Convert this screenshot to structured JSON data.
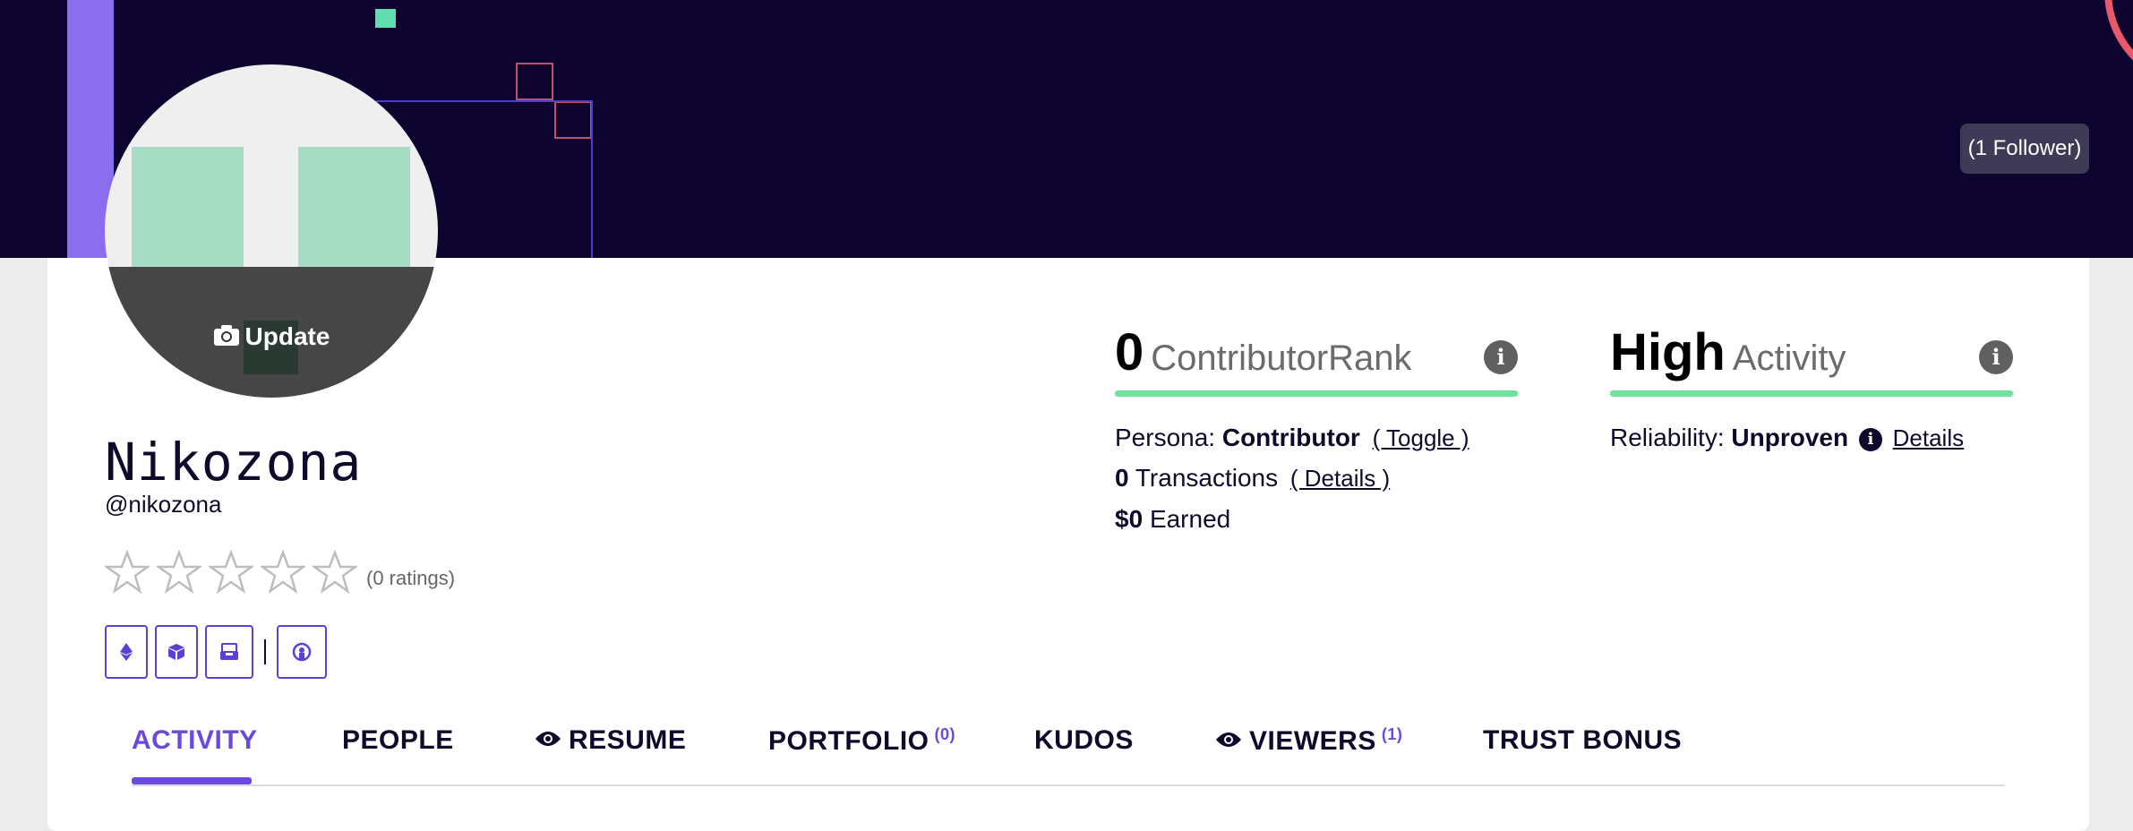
{
  "banner": {
    "follower_badge": "(1 Follower)"
  },
  "avatar": {
    "update_label": "Update"
  },
  "profile": {
    "name": "Nikozona",
    "handle": "@nikozona",
    "ratings_text": "(0 ratings)",
    "stars_filled": 0,
    "stars_total": 5
  },
  "icon_buttons": [
    "ethereum-icon",
    "cube-icon",
    "inbox-icon",
    "github-icon"
  ],
  "contributor": {
    "rank_value": "0",
    "rank_label": "ContributorRank",
    "persona_label": "Persona:",
    "persona_value": "Contributor",
    "persona_link": "( Toggle )",
    "transactions_value": "0",
    "transactions_label": "Transactions",
    "transactions_link": "( Details )",
    "earned_value": "$0",
    "earned_label": "Earned"
  },
  "activity": {
    "level_value": "High",
    "level_label": "Activity",
    "reliability_label": "Reliability:",
    "reliability_value": "Unproven",
    "reliability_link": "Details"
  },
  "tabs": [
    {
      "label": "ACTIVITY",
      "active": true
    },
    {
      "label": "PEOPLE"
    },
    {
      "label": "RESUME",
      "icon": "eye-icon"
    },
    {
      "label": "PORTFOLIO",
      "count": "(0)"
    },
    {
      "label": "KUDOS"
    },
    {
      "label": "VIEWERS",
      "icon": "eye-icon",
      "count": "(1)"
    },
    {
      "label": "TRUST BONUS"
    }
  ],
  "colors": {
    "accent": "#6b48e0",
    "banner": "#0d0530",
    "progress": "#6fe29b"
  }
}
